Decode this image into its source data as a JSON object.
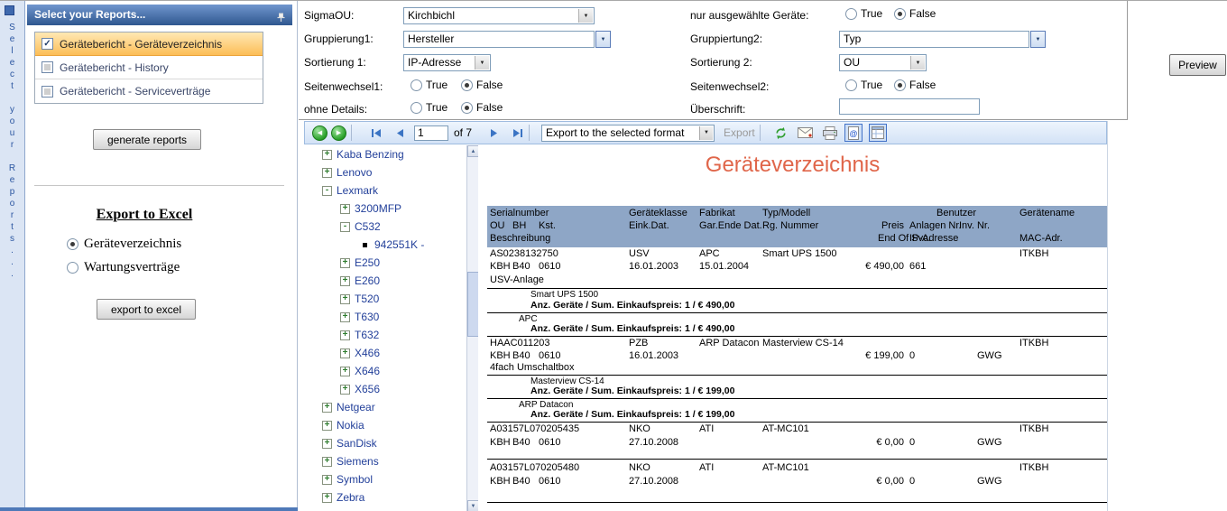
{
  "strip": {
    "vertical_text": "Select your Reports..."
  },
  "icons": {
    "check": "✓",
    "dropdown": "▼",
    "back": "◀",
    "forward": "▶",
    "up": "▲",
    "down": "▼"
  },
  "panel": {
    "title": "Select your Reports...",
    "items": [
      {
        "label": "Gerätebericht - Geräteverzeichnis",
        "checked": true
      },
      {
        "label": "Gerätebericht - History",
        "checked": false
      },
      {
        "label": "Gerätebericht - Serviceverträge",
        "checked": false
      }
    ],
    "generate_button": "generate reports",
    "excel_heading": "Export to Excel",
    "excel_option1": "Geräteverzeichnis",
    "excel_option2": "Wartungsverträge",
    "excel_button": "export to excel"
  },
  "form": {
    "sigmaou": {
      "label": "SigmaOU:",
      "value": "Kirchbichl"
    },
    "gruppierung1": {
      "label": "Gruppierung1:",
      "value": "Hersteller"
    },
    "sortierung1": {
      "label": "Sortierung 1:",
      "value": "IP-Adresse"
    },
    "seitenwechsel1": {
      "label": "Seitenwechsel1:",
      "selected": "False"
    },
    "ohne_details": {
      "label": "ohne Details:",
      "selected": "False"
    },
    "nur_ausgewaehlte": {
      "label": "nur ausgewählte Geräte:",
      "selected": "False"
    },
    "gruppiertung2": {
      "label": "Gruppiertung2:",
      "value": "Typ"
    },
    "sortierung2": {
      "label": "Sortierung 2:",
      "value": "OU"
    },
    "seitenwechsel2": {
      "label": "Seitenwechsel2:",
      "selected": "False"
    },
    "ueberschrift": {
      "label": "Überschrift:",
      "value": ""
    },
    "radio_true": "True",
    "radio_false": "False",
    "preview": "Preview"
  },
  "toolbar": {
    "page_value": "1",
    "page_total": "of 7",
    "export_format": "Export to the selected format",
    "export_label": "Export"
  },
  "tree": {
    "items": [
      {
        "label": "Kaba Benzing",
        "glyph": "+"
      },
      {
        "label": "Lenovo",
        "glyph": "+"
      },
      {
        "label": "Lexmark",
        "glyph": "-"
      },
      {
        "label": "3200MFP",
        "glyph": "+"
      },
      {
        "label": "C532",
        "glyph": "-"
      },
      {
        "label": "942551K -",
        "glyph": ""
      },
      {
        "label": "E250",
        "glyph": "+"
      },
      {
        "label": "E260",
        "glyph": "+"
      },
      {
        "label": "T520",
        "glyph": "+"
      },
      {
        "label": "T630",
        "glyph": "+"
      },
      {
        "label": "T632",
        "glyph": "+"
      },
      {
        "label": "X466",
        "glyph": "+"
      },
      {
        "label": "X646",
        "glyph": "+"
      },
      {
        "label": "X656",
        "glyph": "+"
      },
      {
        "label": "Netgear",
        "glyph": "+"
      },
      {
        "label": "Nokia",
        "glyph": "+"
      },
      {
        "label": "SanDisk",
        "glyph": "+"
      },
      {
        "label": "Siemens",
        "glyph": "+"
      },
      {
        "label": "Symbol",
        "glyph": "+"
      },
      {
        "label": "Zebra",
        "glyph": "+"
      }
    ]
  },
  "report": {
    "title": "Geräteverzeichnis",
    "h1": {
      "serial": "Serialnumber",
      "klasse": "Geräteklasse",
      "fabrikat": "Fabrikat",
      "modell": "Typ/Modell",
      "benutzer": "Benutzer",
      "name": "Gerätename"
    },
    "h2": {
      "ou": "OU",
      "bh": "BH",
      "kst": "Kst.",
      "eink": "Eink.Dat.",
      "gar": "Gar.Ende Dat.",
      "rg": "Rg. Nummer",
      "preis": "Preis",
      "anlagen": "Anlagen Nr.",
      "inv": "Inv. Nr."
    },
    "h3": {
      "beschreibung": "Beschreibung",
      "endsvc": "End Of Svc.",
      "ip": "IP-Adresse",
      "mac": "MAC-Adr."
    },
    "devices": [
      {
        "serial": "AS0238132750",
        "klasse": "USV",
        "fabrikat": "APC",
        "modell": "Smart UPS 1500",
        "name": "ITKBH",
        "ou": "KBH",
        "bh": "B40",
        "kst": "0610",
        "eink": "16.01.2003",
        "gar": "15.01.2004",
        "preis": "€ 490,00",
        "anlagen": "661",
        "inv": "",
        "beschreibung": "USV-Anlage"
      },
      {
        "serial": "HAAC011203",
        "klasse": "PZB",
        "fabrikat": "ARP Datacon",
        "modell": "Masterview CS-14",
        "name": "ITKBH",
        "ou": "KBH",
        "bh": "B40",
        "kst": "0610",
        "eink": "16.01.2003",
        "gar": "",
        "preis": "€ 199,00",
        "anlagen": "0",
        "inv": "GWG",
        "beschreibung": "4fach Umschaltbox"
      },
      {
        "serial": "A03157L070205435",
        "klasse": "NKO",
        "fabrikat": "ATI",
        "modell": "AT-MC101",
        "name": "ITKBH",
        "ou": "KBH",
        "bh": "B40",
        "kst": "0610",
        "eink": "27.10.2008",
        "gar": "",
        "preis": "€ 0,00",
        "anlagen": "0",
        "inv": "GWG",
        "beschreibung": ""
      },
      {
        "serial": "A03157L070205480",
        "klasse": "NKO",
        "fabrikat": "ATI",
        "modell": "AT-MC101",
        "name": "ITKBH",
        "ou": "KBH",
        "bh": "B40",
        "kst": "0610",
        "eink": "27.10.2008",
        "gar": "",
        "preis": "€ 0,00",
        "anlagen": "0",
        "inv": "GWG",
        "beschreibung": ""
      }
    ],
    "summaries": [
      {
        "label": "Smart UPS 1500",
        "line": "Anz. Geräte / Sum. Einkaufspreis: 1 / € 490,00"
      },
      {
        "label": "APC",
        "line": "Anz. Geräte / Sum. Einkaufspreis: 1 / € 490,00"
      },
      {
        "label": "Masterview CS-14",
        "line": "Anz. Geräte / Sum. Einkaufspreis: 1 / € 199,00"
      },
      {
        "label": "ARP Datacon",
        "line": "Anz. Geräte / Sum. Einkaufspreis: 1 / € 199,00"
      }
    ]
  }
}
